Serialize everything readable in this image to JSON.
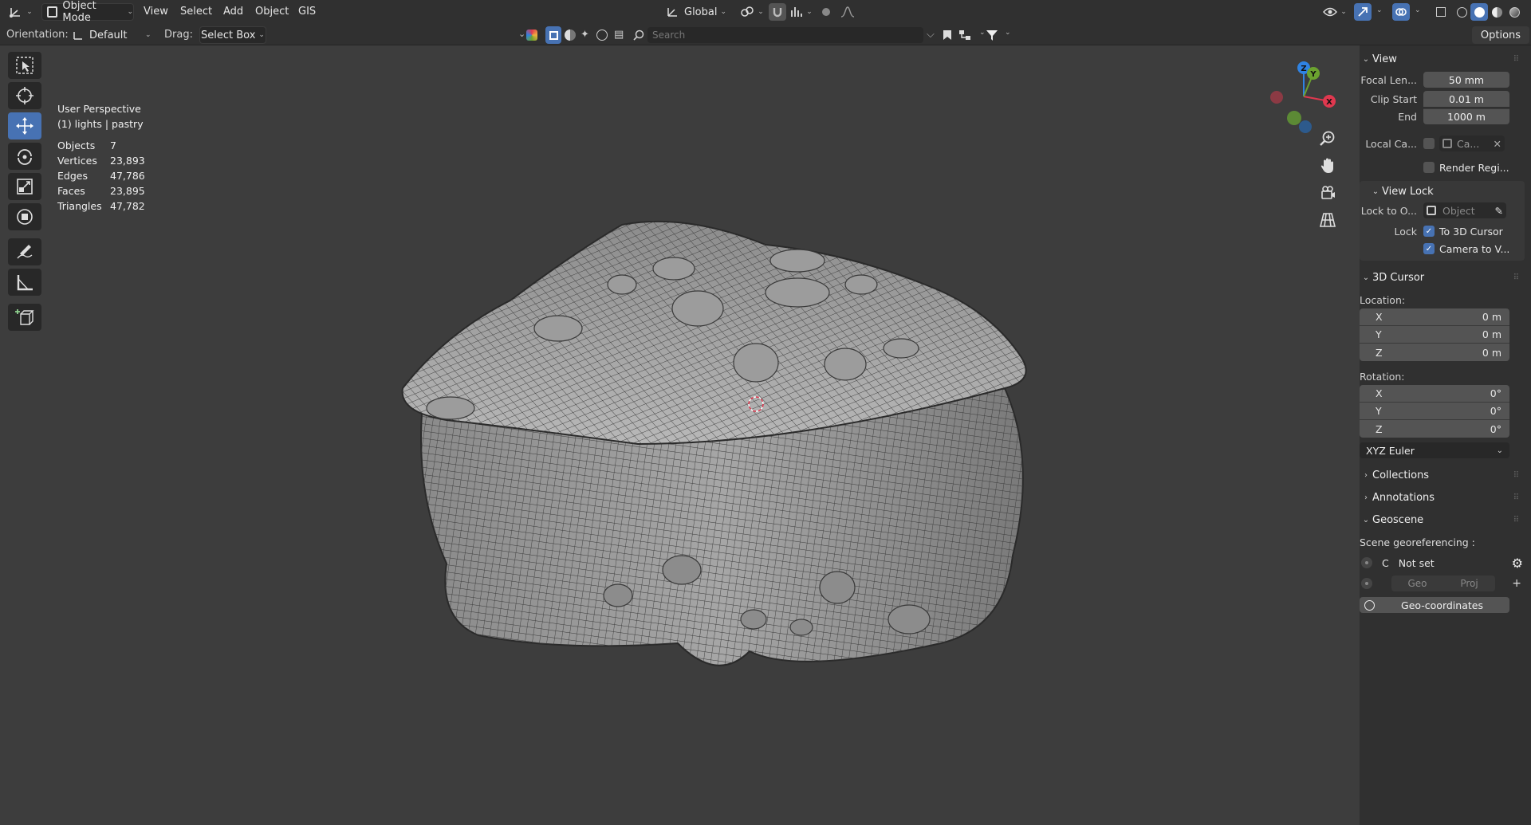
{
  "header": {
    "mode_label": "Object Mode",
    "menus": [
      "View",
      "Select",
      "Add",
      "Object",
      "GIS"
    ],
    "transform_orientation": "Global",
    "options_label": "Options"
  },
  "tool_settings": {
    "orientation_label": "Orientation:",
    "orientation_value": "Default",
    "drag_label": "Drag:",
    "drag_value": "Select Box",
    "search_placeholder": "Search"
  },
  "viewport": {
    "view_name": "User Perspective",
    "collection_line": "(1) lights | pastry",
    "stats": [
      {
        "label": "Objects",
        "value": "7"
      },
      {
        "label": "Vertices",
        "value": "23,893"
      },
      {
        "label": "Edges",
        "value": "47,786"
      },
      {
        "label": "Faces",
        "value": "23,895"
      },
      {
        "label": "Triangles",
        "value": "47,782"
      }
    ],
    "gizmo_axes": {
      "x": "X",
      "y": "Y",
      "z": "Z"
    }
  },
  "sidebar": {
    "view": {
      "title": "View",
      "focal_label": "Focal Len...",
      "focal_value": "50 mm",
      "clip_start_label": "Clip Start",
      "clip_start_value": "0.01 m",
      "end_label": "End",
      "end_value": "1000 m",
      "local_camera_label": "Local Ca...",
      "local_camera_value": "Ca...",
      "render_region_label": "Render Regi..."
    },
    "view_lock": {
      "title": "View Lock",
      "lock_to_label": "Lock to O...",
      "lock_to_placeholder": "Object",
      "lock_label": "Lock",
      "to_cursor_label": "To 3D Cursor",
      "camera_to_view_label": "Camera to V..."
    },
    "cursor": {
      "title": "3D Cursor",
      "location_label": "Location:",
      "location": [
        {
          "axis": "X",
          "value": "0 m"
        },
        {
          "axis": "Y",
          "value": "0 m"
        },
        {
          "axis": "Z",
          "value": "0 m"
        }
      ],
      "rotation_label": "Rotation:",
      "rotation": [
        {
          "axis": "X",
          "value": "0°"
        },
        {
          "axis": "Y",
          "value": "0°"
        },
        {
          "axis": "Z",
          "value": "0°"
        }
      ],
      "rotation_mode": "XYZ Euler"
    },
    "collections_title": "Collections",
    "annotations_title": "Annotations",
    "geoscene": {
      "title": "Geoscene",
      "georef_label": "Scene georeferencing :",
      "crs_letter": "C",
      "crs_value": "Not set",
      "geo_label": "Geo",
      "proj_label": "Proj",
      "geo_coords_label": "Geo-coordinates"
    }
  },
  "colors": {
    "accent": "#4772b3",
    "axis_x": "#e0384f",
    "axis_y": "#6ba22f",
    "axis_z": "#2f83e3"
  }
}
